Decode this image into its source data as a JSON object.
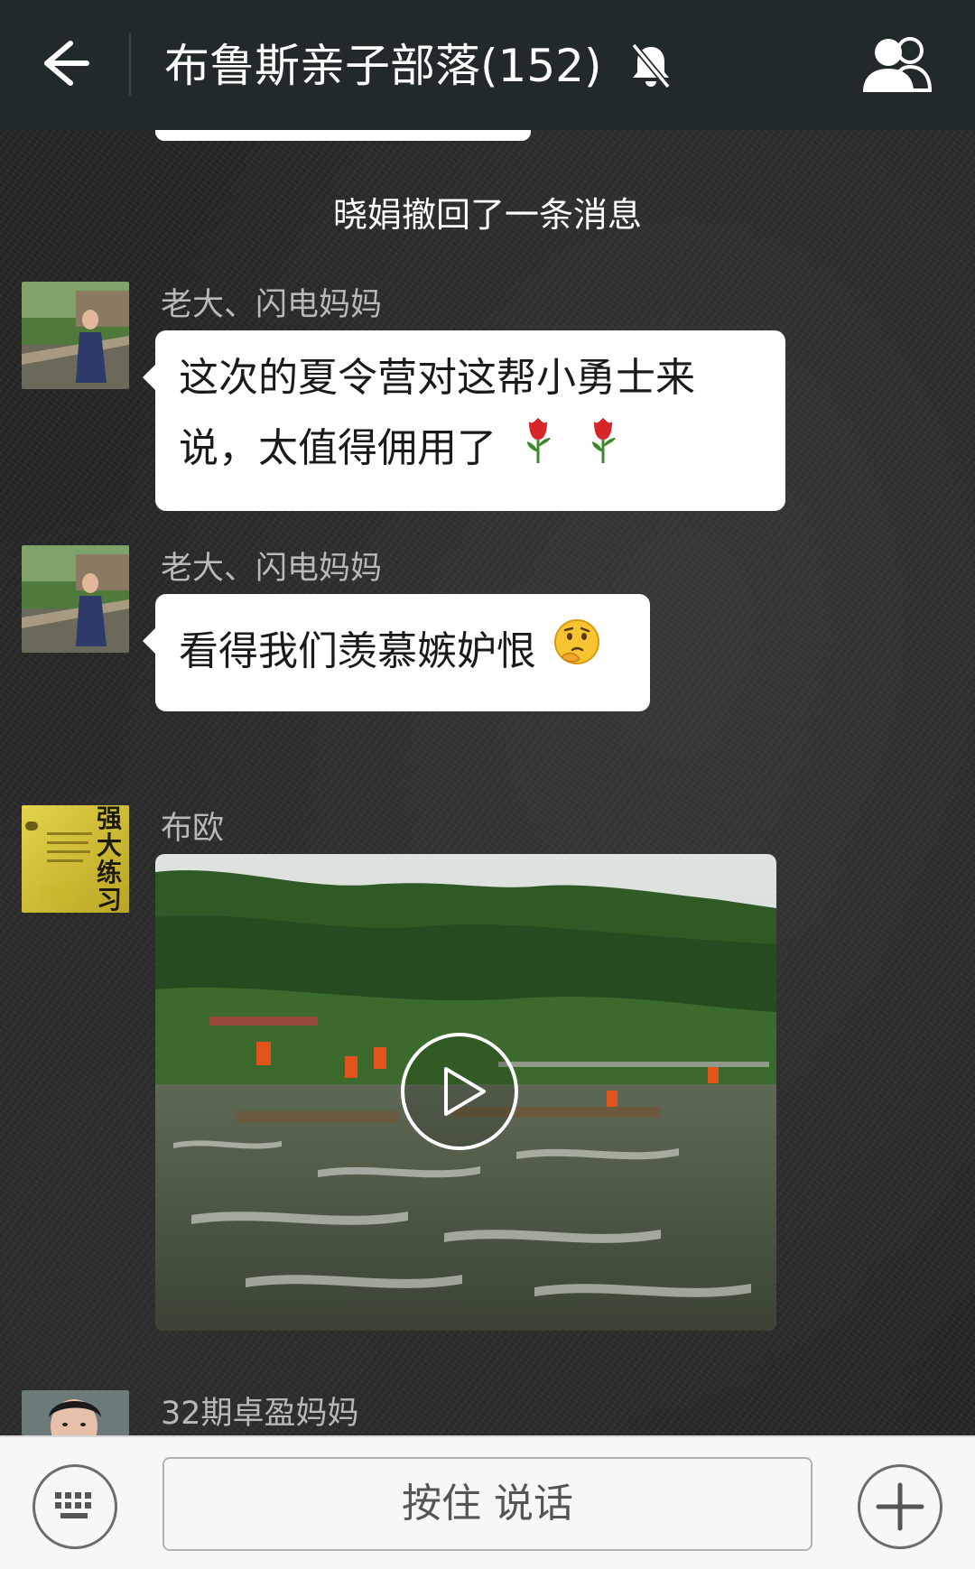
{
  "header": {
    "title": "布鲁斯亲子部落(152)",
    "back_icon": "arrow-left-icon",
    "mute_icon": "bell-muted-icon",
    "members_icon": "group-members-icon"
  },
  "system_notice": "晓娟撤回了一条消息",
  "messages": [
    {
      "sender": "老大、闪电妈妈",
      "text_line1": "这次的夏令营对这帮小勇士来",
      "text_line2": "说，太值得佣用了",
      "emojis": [
        "rose-emoji",
        "rose-emoji"
      ]
    },
    {
      "sender": "老大、闪电妈妈",
      "text": "看得我们羡慕嫉妒恨",
      "emojis": [
        "thinking-face-emoji"
      ]
    },
    {
      "sender": "布欧",
      "type": "video",
      "play_icon": "play-icon",
      "avatar_text": "强大练习"
    },
    {
      "sender": "32期卓盈妈妈"
    }
  ],
  "input_bar": {
    "hold_to_talk_label": "按住 说话",
    "keyboard_icon": "keyboard-icon",
    "plus_icon": "plus-icon"
  }
}
